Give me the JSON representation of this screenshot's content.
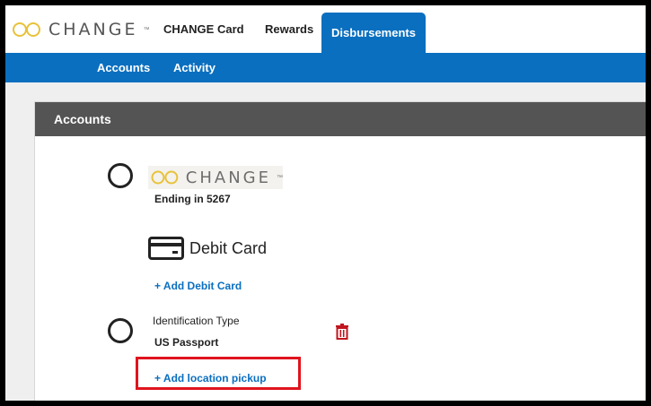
{
  "brand": {
    "name": "CHANGE"
  },
  "nav": {
    "tabs": [
      {
        "label": "CHANGE Card"
      },
      {
        "label": "Rewards"
      },
      {
        "label": "Disbursements",
        "active": true
      }
    ]
  },
  "subnav": {
    "items": [
      {
        "label": "Accounts"
      },
      {
        "label": "Activity"
      }
    ]
  },
  "panel": {
    "title": "Accounts",
    "change_account": {
      "brand": "CHANGE",
      "ending": "Ending in 5267"
    },
    "debit": {
      "title": "Debit Card",
      "add_link": "+ Add Debit Card"
    },
    "identification": {
      "label": "Identification Type",
      "value": "US Passport",
      "add_pickup_link": "+ Add location pickup"
    }
  },
  "colors": {
    "accent": "#0a6fbf",
    "logo_gold": "#e8c23a",
    "header_gray": "#545454",
    "delete_red": "#c0151f",
    "highlight_red": "#e0141e"
  },
  "icons": [
    "infinity-logo-icon",
    "credit-card-icon",
    "trash-icon",
    "radio-button-icon"
  ]
}
